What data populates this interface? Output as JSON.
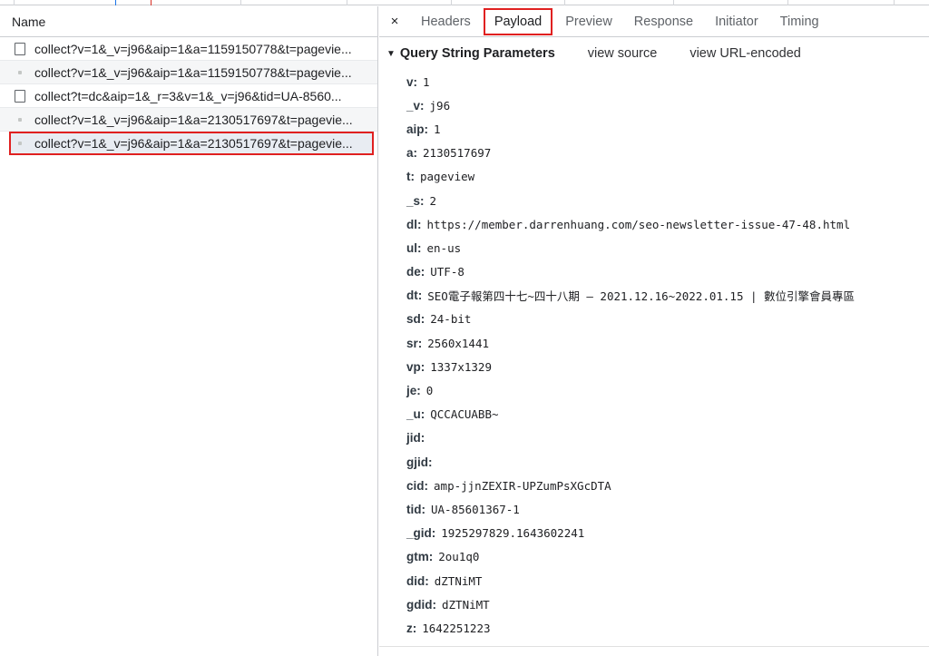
{
  "left_panel": {
    "header": "Name",
    "requests": [
      {
        "label": "collect?v=1&_v=j96&aip=1&a=1159150778&t=pagevie...",
        "icon": "document-icon",
        "selected": false
      },
      {
        "label": "collect?v=1&_v=j96&aip=1&a=1159150778&t=pagevie...",
        "icon": "dot-icon",
        "selected": false
      },
      {
        "label": "collect?t=dc&aip=1&_r=3&v=1&_v=j96&tid=UA-8560...",
        "icon": "document-icon",
        "selected": false
      },
      {
        "label": "collect?v=1&_v=j96&aip=1&a=2130517697&t=pagevie...",
        "icon": "dot-icon",
        "selected": false
      },
      {
        "label": "collect?v=1&_v=j96&aip=1&a=2130517697&t=pagevie...",
        "icon": "dot-icon",
        "selected": true
      }
    ]
  },
  "right_panel": {
    "tabs": {
      "close_label": "×",
      "headers": "Headers",
      "payload": "Payload",
      "preview": "Preview",
      "response": "Response",
      "initiator": "Initiator",
      "timing": "Timing",
      "active": "Payload"
    },
    "section": {
      "caret": "▼",
      "title": "Query String Parameters",
      "view_source": "view source",
      "view_url_encoded": "view URL-encoded"
    },
    "params": [
      {
        "key": "v:",
        "value": "1"
      },
      {
        "key": "_v:",
        "value": "j96"
      },
      {
        "key": "aip:",
        "value": "1"
      },
      {
        "key": "a:",
        "value": "2130517697"
      },
      {
        "key": "t:",
        "value": "pageview"
      },
      {
        "key": "_s:",
        "value": "2"
      },
      {
        "key": "dl:",
        "value": "https://member.darrenhuang.com/seo-newsletter-issue-47-48.html"
      },
      {
        "key": "ul:",
        "value": "en-us"
      },
      {
        "key": "de:",
        "value": "UTF-8"
      },
      {
        "key": "dt:",
        "value": "SEO電子報第四十七~四十八期 – 2021.12.16~2022.01.15 | 數位引擎會員專區"
      },
      {
        "key": "sd:",
        "value": "24-bit"
      },
      {
        "key": "sr:",
        "value": "2560x1441"
      },
      {
        "key": "vp:",
        "value": "1337x1329"
      },
      {
        "key": "je:",
        "value": "0"
      },
      {
        "key": "_u:",
        "value": "QCCACUABB~"
      },
      {
        "key": "jid:",
        "value": ""
      },
      {
        "key": "gjid:",
        "value": ""
      },
      {
        "key": "cid:",
        "value": "amp-jjnZEXIR-UPZumPsXGcDTA"
      },
      {
        "key": "tid:",
        "value": "UA-85601367-1"
      },
      {
        "key": "_gid:",
        "value": "1925297829.1643602241"
      },
      {
        "key": "gtm:",
        "value": "2ou1q0"
      },
      {
        "key": "did:",
        "value": "dZTNiMT"
      },
      {
        "key": "gdid:",
        "value": "dZTNiMT"
      },
      {
        "key": "z:",
        "value": "1642251223"
      }
    ]
  },
  "colors": {
    "highlight_border": "#e02020",
    "selected_row": "#e8ecf2",
    "divider": "#cbcdd1"
  }
}
